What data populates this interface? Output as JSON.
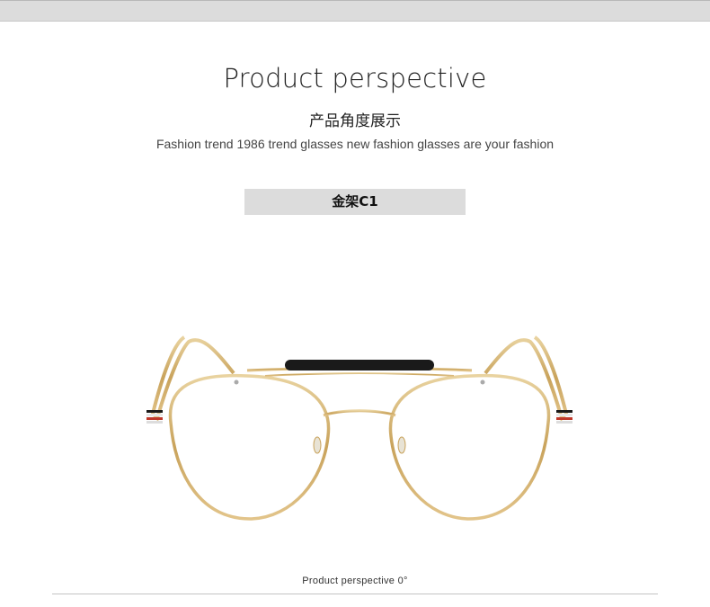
{
  "header": {
    "title": "Product perspective",
    "subtitle_cn": "产品角度展示",
    "tagline": "Fashion trend 1986 trend glasses new fashion glasses are your fashion"
  },
  "variant": {
    "label": "金架C1"
  },
  "product_image": {
    "icon": "glasses-icon",
    "frame_color": "#d4b06a",
    "bar_color": "#1a1a1a"
  },
  "caption": {
    "text": "Product perspective 0°"
  }
}
